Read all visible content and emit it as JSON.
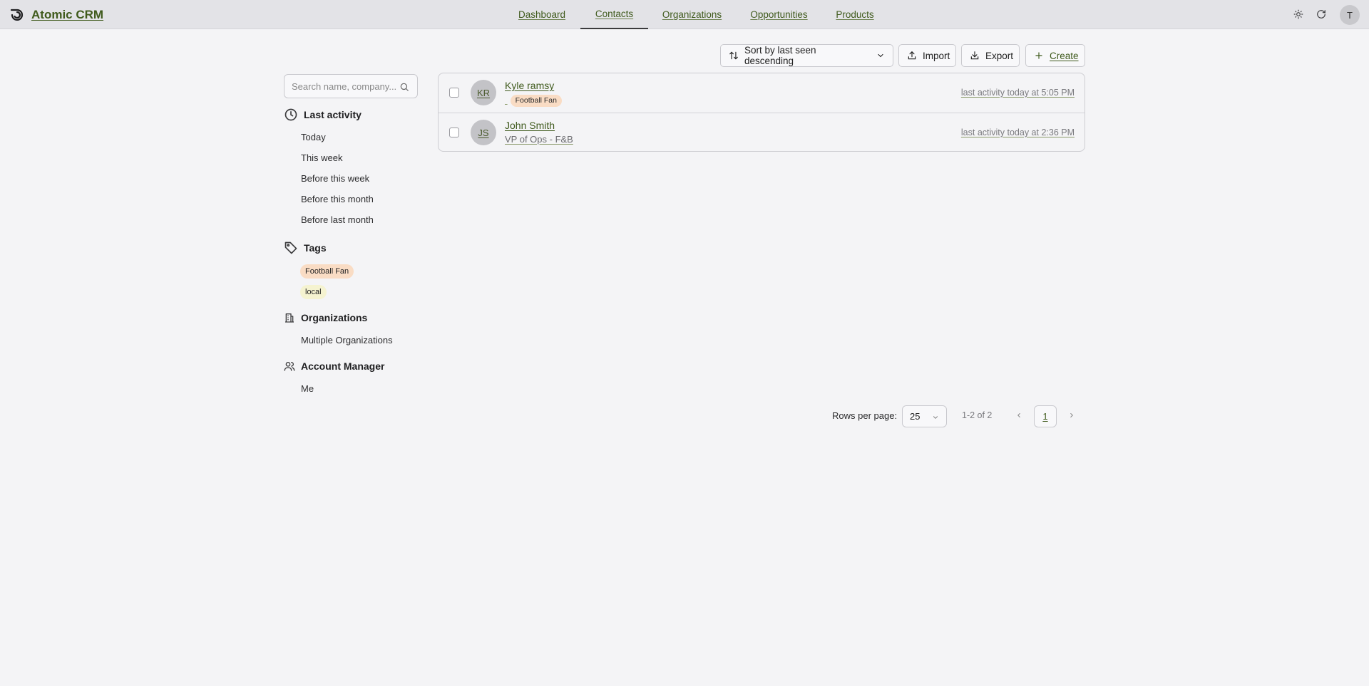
{
  "app": {
    "name": "Atomic CRM",
    "user_initial": "T"
  },
  "nav": {
    "items": [
      {
        "label": "Dashboard",
        "active": false
      },
      {
        "label": "Contacts",
        "active": true
      },
      {
        "label": "Organizations",
        "active": false
      },
      {
        "label": "Opportunities",
        "active": false
      },
      {
        "label": "Products",
        "active": false
      }
    ]
  },
  "header_icons": [
    "sun-icon",
    "refresh-icon"
  ],
  "toolbar": {
    "sort_label": "Sort by last seen descending",
    "import_label": "Import",
    "export_label": "Export",
    "create_label": "Create"
  },
  "search": {
    "placeholder": "Search name, company..."
  },
  "filters": {
    "last_activity": {
      "title": "Last activity",
      "items": [
        "Today",
        "This week",
        "Before this week",
        "Before this month",
        "Before last month"
      ]
    },
    "tags": {
      "title": "Tags",
      "items": [
        {
          "label": "Football Fan",
          "color": "#f9dcc4"
        },
        {
          "label": "local",
          "color": "#f5f3d0"
        }
      ]
    },
    "organizations": {
      "title": "Organizations",
      "items": [
        "Multiple Organizations"
      ]
    },
    "account_manager": {
      "title": "Account Manager",
      "items": [
        "Me"
      ]
    }
  },
  "contacts": [
    {
      "initials": "KR",
      "name": "Kyle ramsy",
      "title": "",
      "tag": {
        "label": "Football Fan",
        "color": "#f9dcc4"
      },
      "activity": "last activity today at 5:05 PM"
    },
    {
      "initials": "JS",
      "name": "John Smith",
      "title": "VP of Ops - F&B",
      "tag": null,
      "activity": "last activity today at 2:36 PM"
    }
  ],
  "pagination": {
    "rows_label": "Rows per page:",
    "rows_value": "25",
    "range": "1-2 of 2",
    "current_page": "1"
  },
  "colors": {
    "accent": "#3f5a1c",
    "background": "#f4f4f6",
    "header": "#e3e3e7"
  }
}
